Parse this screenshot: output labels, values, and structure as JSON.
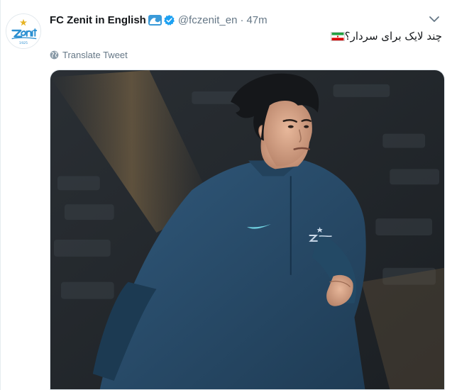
{
  "tweet": {
    "display_name": "FC Zenit in English",
    "handle": "@fczenit_en",
    "separator": "·",
    "time": "47m",
    "text": "چند لایک برای سردار؟",
    "translate_label": "Translate Tweet"
  },
  "avatar": {
    "logo_text": "Zenit",
    "logo_year": "1925"
  },
  "icons": {
    "wave": "wave-emoji-icon",
    "verified": "verified-badge-icon",
    "caret": "chevron-down-icon",
    "globe": "globe-icon",
    "flag": "iran-flag-emoji"
  },
  "colors": {
    "brand_blue": "#1da1f2",
    "zenit_blue": "#2a8fd1",
    "jacket": "#2b4f6b",
    "muted_text": "#657786"
  }
}
